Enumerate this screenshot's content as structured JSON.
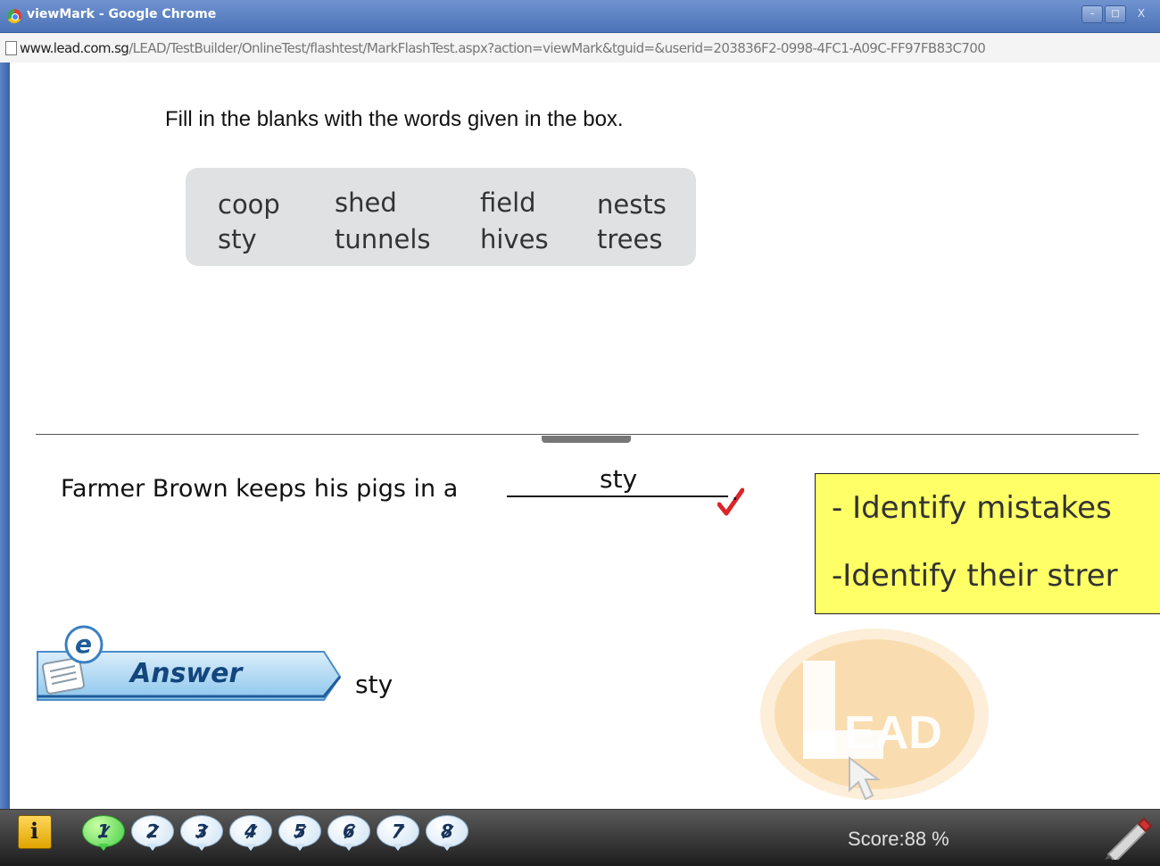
{
  "window": {
    "title": "viewMark - Google Chrome",
    "buttons": {
      "minimize": "–",
      "maximize": "□",
      "close": "X"
    }
  },
  "address_bar": {
    "domain": "www.lead.com.sg",
    "path": "/LEAD/TestBuilder/OnlineTest/flashtest/MarkFlashTest.aspx?action=viewMark&tguid=&userid=203836F2-0998-4FC1-A09C-FF97FB83C700"
  },
  "question_panel": {
    "instruction": "Fill in the blanks with the words given in the box.",
    "word_box": {
      "row1": [
        "coop",
        "shed",
        "field",
        "nests"
      ],
      "row2": [
        "sty",
        "tunnels",
        "hives",
        "trees"
      ]
    }
  },
  "answer_panel": {
    "sentence": "Farmer Brown keeps his pigs in a",
    "student_answer": "sty",
    "sentence_end": ".",
    "answer_label": "Answer",
    "answer_value": "sty"
  },
  "note": {
    "line1": "- Identify mistakes",
    "line2": "-Identify their strer"
  },
  "footer": {
    "question_buttons": [
      "1",
      "2",
      "3",
      "4",
      "5",
      "6",
      "7",
      "8"
    ],
    "active_question": 1,
    "score": "Score:88 %",
    "info_label": "i"
  },
  "icons": {
    "browser": "chrome-icon",
    "page": "page-icon",
    "tick": "checkmark-icon",
    "answer_badge": "e-answer-icon",
    "logo": "lead-logo",
    "cursor": "cursor-icon",
    "pen": "pen-icon"
  },
  "colors": {
    "titlebar": "#4c73b8",
    "note_background": "#ffff66",
    "tick": "#d9262a",
    "active_question": "#48d04a",
    "answer_text": "#13467d"
  }
}
